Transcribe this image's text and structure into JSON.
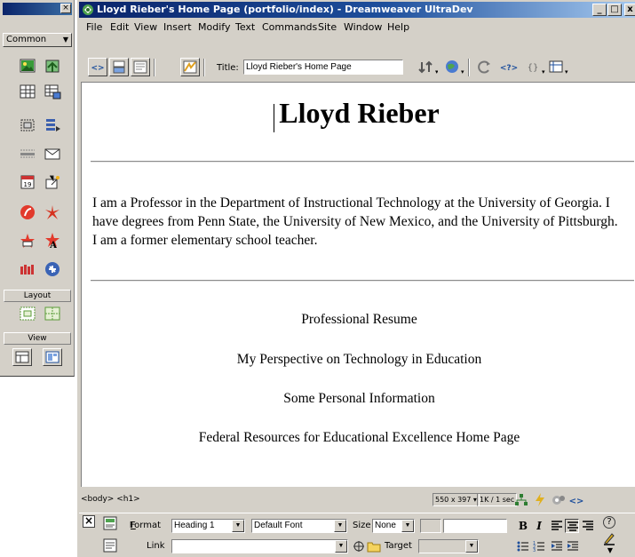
{
  "objects_panel": {
    "category": "Common",
    "layout_label": "Layout",
    "view_label": "View",
    "common_buttons": [
      "insert-image",
      "insert-rollover-image",
      "insert-table",
      "insert-tabular-data",
      "insert-layer",
      "insert-navigation-bar",
      "insert-horizontal-rule",
      "insert-email-link",
      "insert-date",
      "insert-fireworks-html",
      "insert-flash",
      "insert-shockwave",
      "insert-flash-button",
      "insert-flash-text",
      "insert-generator",
      "insert-fireworks"
    ]
  },
  "window": {
    "title": "Lloyd Rieber's Home Page (portfolio/index) - Dreamweaver UltraDev",
    "minimize": "_",
    "maximize": "□",
    "close": "x"
  },
  "menubar": {
    "items": [
      "File",
      "Edit",
      "View",
      "Insert",
      "Modify",
      "Text",
      "Commands",
      "Site",
      "Window",
      "Help"
    ]
  },
  "toolbar": {
    "title_label": "Title:",
    "title_value": "Lloyd Rieber's Home Page",
    "code_label": "<?>",
    "braces_label": "{}"
  },
  "document": {
    "heading": "Lloyd Rieber",
    "bio": "I am a Professor in the Department of Instructional Technology at the University of Georgia. I have degrees from Penn State, the University of New Mexico, and the University of Pittsburgh. I am a former elementary school teacher.",
    "links": [
      "Professional Resume",
      "My Perspective on Technology in Education",
      "Some Personal Information",
      "Federal Resources for Educational Excellence Home Page"
    ]
  },
  "statusbar": {
    "tag_selector": "<body> <h1>",
    "window_size": "550 x 397",
    "download_stats": "1K / 1 sec"
  },
  "inspector": {
    "format_label": "Format",
    "format_value": "Heading 1",
    "font_value": "Default Font",
    "size_label": "Size",
    "size_value": "None",
    "link_label": "Link",
    "link_value": "",
    "target_label": "Target",
    "target_value": "",
    "bold": "B",
    "italic": "I",
    "help": "?"
  },
  "colors": {
    "chrome": "#d4d0c8",
    "titlebar_start": "#0a246a",
    "titlebar_end": "#a6caf0"
  }
}
